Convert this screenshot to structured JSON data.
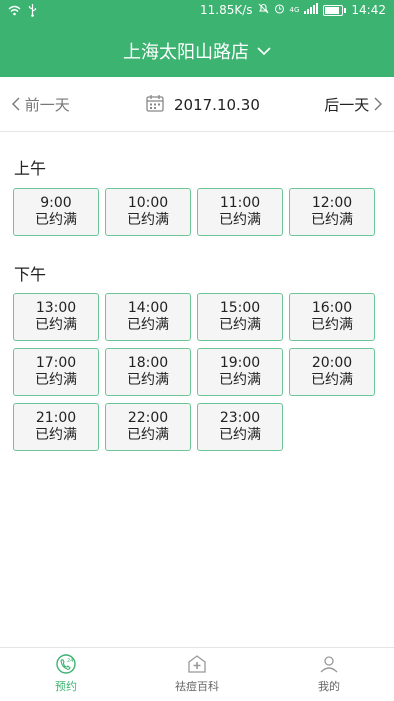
{
  "status_bar": {
    "speed": "11.85K/s",
    "network": "4G",
    "time": "14:42"
  },
  "header": {
    "store_name": "上海太阳山路店"
  },
  "date_nav": {
    "prev_label": "前一天",
    "date": "2017.10.30",
    "next_label": "后一天"
  },
  "morning": {
    "title": "上午",
    "slots": [
      {
        "time": "9:00",
        "status": "已约满"
      },
      {
        "time": "10:00",
        "status": "已约满"
      },
      {
        "time": "11:00",
        "status": "已约满"
      },
      {
        "time": "12:00",
        "status": "已约满"
      }
    ]
  },
  "afternoon": {
    "title": "下午",
    "slots": [
      {
        "time": "13:00",
        "status": "已约满"
      },
      {
        "time": "14:00",
        "status": "已约满"
      },
      {
        "time": "15:00",
        "status": "已约满"
      },
      {
        "time": "16:00",
        "status": "已约满"
      },
      {
        "time": "17:00",
        "status": "已约满"
      },
      {
        "time": "18:00",
        "status": "已约满"
      },
      {
        "time": "19:00",
        "status": "已约满"
      },
      {
        "time": "20:00",
        "status": "已约满"
      },
      {
        "time": "21:00",
        "status": "已约满"
      },
      {
        "time": "22:00",
        "status": "已约满"
      },
      {
        "time": "23:00",
        "status": "已约满"
      }
    ]
  },
  "tabs": [
    {
      "label": "预约",
      "icon": "phone-24-icon"
    },
    {
      "label": "祛痘百科",
      "icon": "pharmacy-icon"
    },
    {
      "label": "我的",
      "icon": "user-icon"
    }
  ],
  "colors": {
    "accent": "#3cb371",
    "slot_border": "#6cc497"
  }
}
